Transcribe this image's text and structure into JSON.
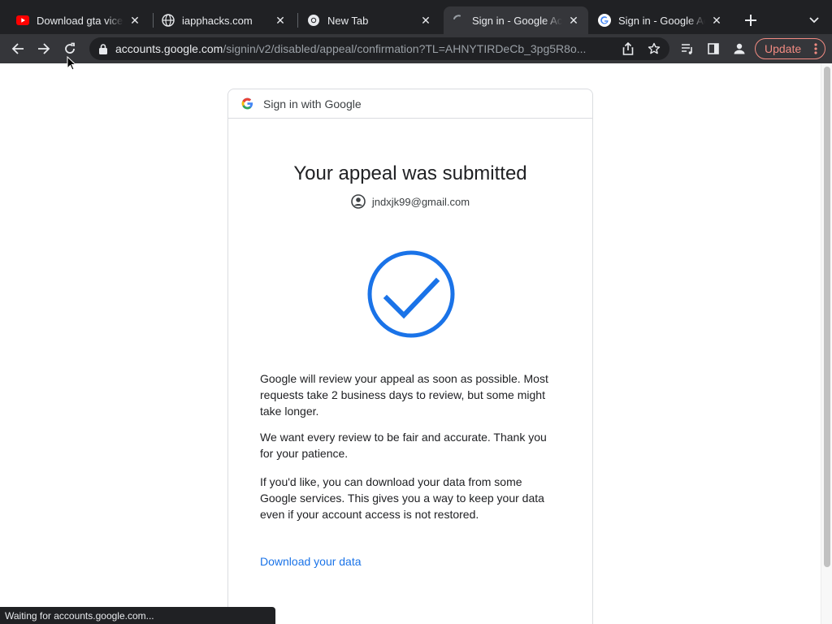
{
  "tabs": [
    {
      "title": "Download gta vice c",
      "icon": "youtube-icon"
    },
    {
      "title": "iapphacks.com",
      "icon": "globe-icon"
    },
    {
      "title": "New Tab",
      "icon": "chrome-icon"
    },
    {
      "title": "Sign in - Google Acc",
      "icon": "loading-spinner-icon"
    },
    {
      "title": "Sign in - Google Acc",
      "icon": "google-icon"
    }
  ],
  "address_bar": {
    "host": "accounts.google.com",
    "path": "/signin/v2/disabled/appeal/confirmation?TL=AHNYTIRDeCb_3pg5R8o..."
  },
  "update_button": {
    "label": "Update"
  },
  "card": {
    "header": "Sign in with Google",
    "headline": "Your appeal was submitted",
    "email": "jndxjk99@gmail.com",
    "paragraphs": [
      "Google will review your appeal as soon as possible. Most requests take 2 business days to review, but some might take longer.",
      "We want every review to be fair and accurate. Thank you for your patience.",
      "If you'd like, you can download your data from some Google services. This gives you a way to keep your data even if your account access is not restored."
    ],
    "download_link": "Download your data"
  },
  "status_bar": "Waiting for accounts.google.com...",
  "colors": {
    "accent_blue": "#1a73e8",
    "checkmark_blue": "#1a73e8",
    "update_red": "#f28b82",
    "tabstrip_bg": "#202124",
    "toolbar_bg": "#35363a"
  }
}
